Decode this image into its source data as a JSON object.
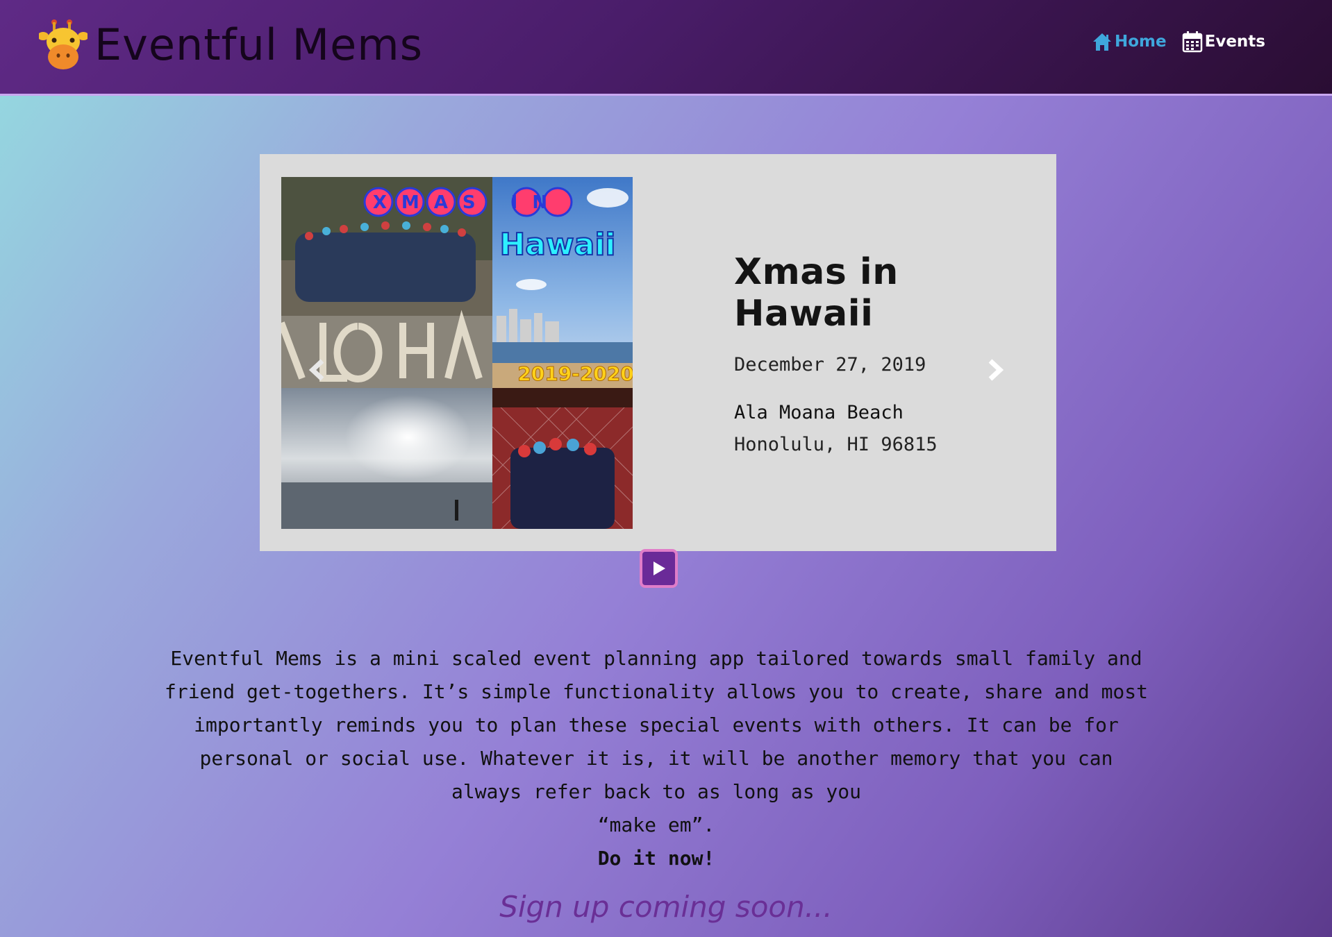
{
  "header": {
    "brand_title": "Eventful Mems",
    "nav": {
      "home_label": "Home",
      "events_label": "Events"
    }
  },
  "carousel": {
    "slide": {
      "image_text": {
        "banner": "XMAS IN",
        "location": "Hawaii",
        "years": "2019-2020",
        "ground": "ALOHA"
      },
      "title": "Xmas in Hawaii",
      "date": "December 27, 2019",
      "place": "Ala Moana Beach",
      "address": "Honolulu, HI 96815"
    },
    "controls": {
      "prev_icon": "chevron-left-icon",
      "next_icon": "chevron-right-icon",
      "play_icon": "play-icon"
    }
  },
  "about": {
    "line1": "Eventful Mems is a mini scaled event planning app tailored towards small family and",
    "line2": "friend get-togethers. It’s simple functionality allows you to create, share and most",
    "line3": "importantly reminds you to plan these special events with others. It can be for",
    "line4": "personal or social use. Whatever it is, it will be another memory that you can",
    "line5": "always refer back to as long as you",
    "line6": "“make em”.",
    "cta": "Do it now!"
  },
  "signup_text": "Sign up coming soon...",
  "colors": {
    "header_start": "#5f2a86",
    "header_end": "#2a0d33",
    "home_link": "#3fa7dc",
    "play_button": "#6a2a98",
    "play_border": "#e07dc9",
    "signup": "#6a2f96",
    "card": "#dbdbdb"
  }
}
